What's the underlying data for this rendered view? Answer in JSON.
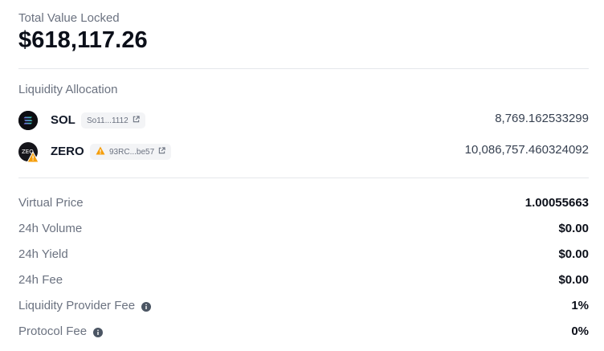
{
  "tvl": {
    "label": "Total Value Locked",
    "value": "$618,117.26"
  },
  "allocation": {
    "label": "Liquidity Allocation",
    "tokens": [
      {
        "icon": "solana-logo-icon",
        "symbol": "SOL",
        "address": "So11...1112",
        "has_warning": false,
        "amount": "8,769.162533299"
      },
      {
        "icon": "zero-token-logo-icon",
        "symbol": "ZERO",
        "address": "93RC...be57",
        "has_warning": true,
        "amount": "10,086,757.460324092"
      }
    ]
  },
  "stats": [
    {
      "label": "Virtual Price",
      "value": "1.00055663",
      "info": false
    },
    {
      "label": "24h Volume",
      "value": "$0.00",
      "info": false
    },
    {
      "label": "24h Yield",
      "value": "$0.00",
      "info": false
    },
    {
      "label": "24h Fee",
      "value": "$0.00",
      "info": false
    },
    {
      "label": "Liquidity Provider Fee",
      "value": "1%",
      "info": true
    },
    {
      "label": "Protocol Fee",
      "value": "0%",
      "info": true
    }
  ],
  "colors": {
    "label_gray": "#6b7280",
    "warning_orange": "#f59e0b",
    "solana_gradient_start": "#9945ff",
    "solana_gradient_end": "#14f195"
  }
}
